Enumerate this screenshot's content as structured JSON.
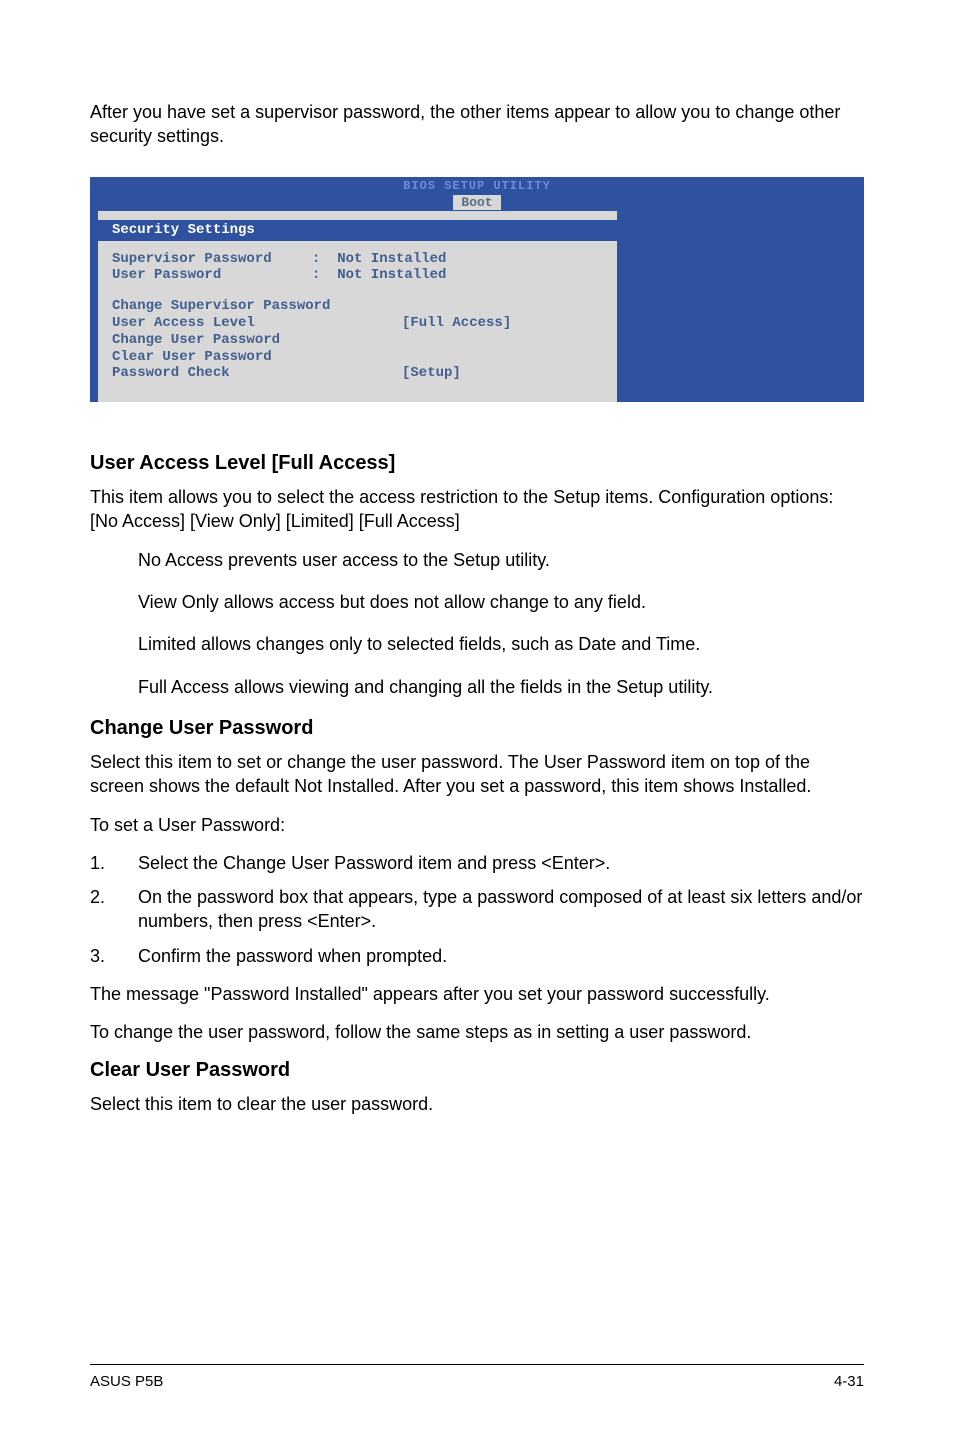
{
  "intro": "After you have set a supervisor password, the other items appear to allow you to change other security settings.",
  "bios": {
    "title_top": "BIOS SETUP UTILITY",
    "tab": "Boot",
    "section": "Security Settings",
    "supervisor_label": "Supervisor Password",
    "supervisor_value": ":  Not Installed",
    "user_label": "User Password",
    "user_value": ":  Not Installed",
    "change_sup": "Change Supervisor Password",
    "ual_label": "User Access Level",
    "ual_value": "[Full Access]",
    "change_user_pw": "Change User Password",
    "clear_user_pw": "Clear User Password",
    "pw_check_label": "Password Check",
    "pw_check_value": "[Setup]"
  },
  "ual": {
    "heading": "User Access Level [Full Access]",
    "p1": "This item allows you to select the access restriction to the Setup items. Configuration options: [No Access] [View Only] [Limited] [Full Access]",
    "no_access": "No Access prevents user access to the Setup utility.",
    "view_only": "View Only allows access but does not allow change to any field.",
    "limited": "Limited allows changes only to selected fields, such as Date and Time.",
    "full_access": "Full Access allows viewing and changing all the fields in the Setup utility."
  },
  "cup": {
    "heading": "Change User Password",
    "p1": "Select this item to set or change the user password. The User Password item on top of the screen shows the default Not Installed. After you set a password, this item shows Installed.",
    "p2": "To set a User Password:",
    "steps": {
      "s1": "Select the Change User Password item and press <Enter>.",
      "s2": "On the password box that appears, type a password composed of at least six letters and/or numbers, then press <Enter>.",
      "s3": "Confirm the password when prompted."
    },
    "p3": "The message \"Password Installed\" appears after you set your password successfully.",
    "p4": "To change the user password, follow the same steps as in setting a user password."
  },
  "clr": {
    "heading": "Clear User Password",
    "p1": "Select this item to clear the user password."
  },
  "footer": {
    "left": "ASUS P5B",
    "right": "4-31"
  }
}
